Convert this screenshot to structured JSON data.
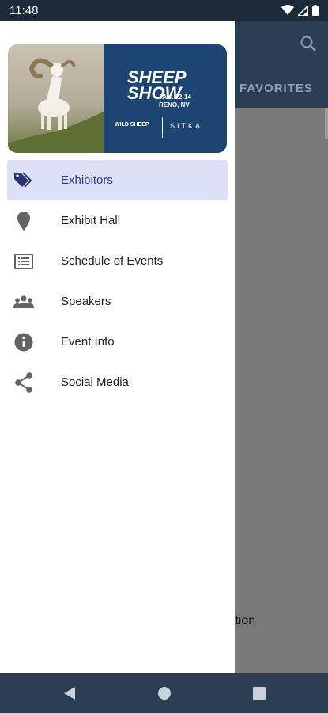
{
  "status_bar": {
    "time": "11:48"
  },
  "background_app": {
    "tab_label": "FAVORITES",
    "partial_text": "sociation"
  },
  "banner": {
    "brand_title_line1": "SHEEP",
    "brand_title_line2": "SHOW",
    "brand_dates": "JAN. 12-14",
    "brand_location": "RENO, NV",
    "brand_left_foot": "WILD SHEEP",
    "brand_right_foot": "SITKA"
  },
  "menu": {
    "items": [
      {
        "label": "Exhibitors",
        "icon": "tag-icon",
        "active": true
      },
      {
        "label": "Exhibit Hall",
        "icon": "map-pin-icon",
        "active": false
      },
      {
        "label": "Schedule of Events",
        "icon": "list-icon",
        "active": false
      },
      {
        "label": "Speakers",
        "icon": "people-icon",
        "active": false
      },
      {
        "label": "Event Info",
        "icon": "info-icon",
        "active": false
      },
      {
        "label": "Social Media",
        "icon": "share-icon",
        "active": false
      }
    ]
  },
  "colors": {
    "status_bar": "#1c2a3a",
    "app_bar": "#2c3e53",
    "brand_blue": "#1d4574",
    "active_bg": "#dde1f8",
    "active_text": "#2f3aa0",
    "active_icon": "#27346d",
    "icon_gray": "#5f6368"
  }
}
